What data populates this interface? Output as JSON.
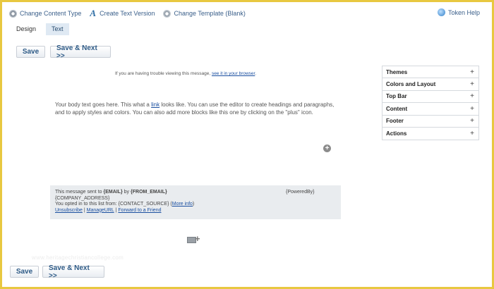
{
  "toolbar": {
    "change_content_type": "Change Content Type",
    "create_text_version": "Create Text Version",
    "change_template": "Change Template (Blank)",
    "token_help": "Token Help"
  },
  "tabs": [
    {
      "label": "Design",
      "active": false
    },
    {
      "label": "Text",
      "active": true
    }
  ],
  "buttons": {
    "save": "Save",
    "save_next": "Save & Next >>"
  },
  "email": {
    "notice_text": "If you are having trouble viewing this message, ",
    "notice_link": "see it in your browser",
    "notice_end": ".",
    "body_1": "Your body text goes here. This what a ",
    "body_link": "link",
    "body_2": " looks like. You can use the editor to create headings and paragraphs, and to apply styles and colors. You can also add more blocks like this one by clicking on the \"plus\" icon.",
    "footer": {
      "sent_prefix": "This message sent to ",
      "email_token": "{EMAIL}",
      "by": " by ",
      "from_token": "{FROM_EMAIL}",
      "powered_by": "{PoweredBy}",
      "company_address": "{COMPANY_ADDRESS}",
      "opted_in": "You opted in to this list from: {CONTACT_SOURCE} (",
      "more_info": "More info",
      "opted_end": ")",
      "unsubscribe": "Unsubscribe",
      "manage_url": "ManageURL",
      "forward": "Forward to a Friend",
      "sep": " | "
    },
    "plus_glyph": "+",
    "add_glyph": "+"
  },
  "side_panel": {
    "items": [
      {
        "label": "Themes",
        "action": "+"
      },
      {
        "label": "Colors and Layout",
        "action": "+"
      },
      {
        "label": "Top Bar",
        "action": "+"
      },
      {
        "label": "Content",
        "action": "+"
      },
      {
        "label": "Footer",
        "action": "+"
      },
      {
        "label": "Actions",
        "action": "+"
      }
    ]
  },
  "watermark": "www.heritagechristiancollege.com",
  "colors": {
    "accent": "#2d5a86",
    "link": "#1a4fa0",
    "frame": "#e8c840"
  }
}
